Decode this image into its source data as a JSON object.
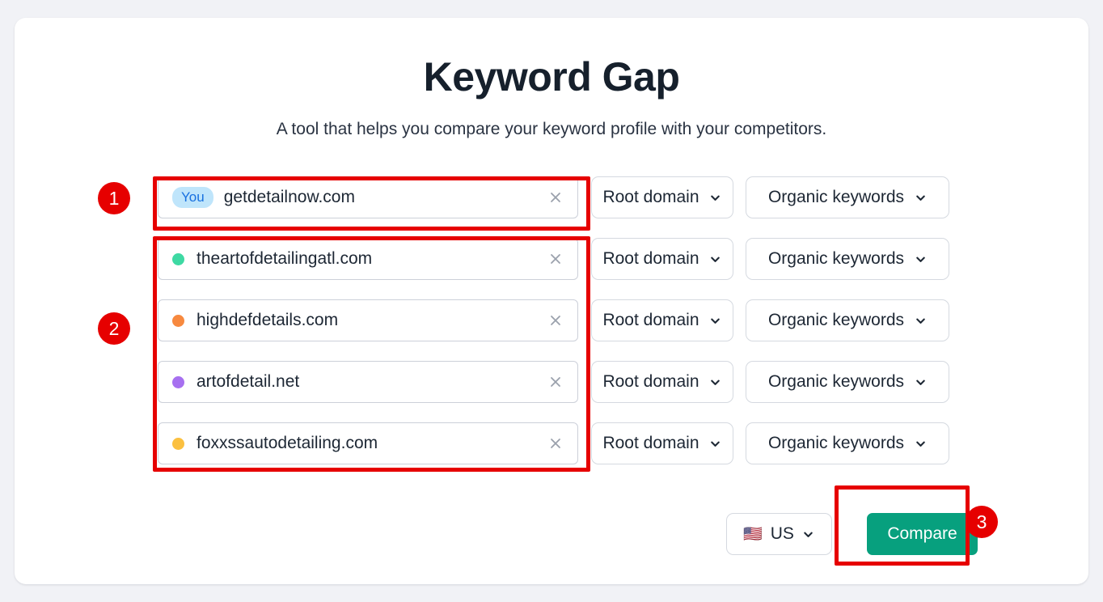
{
  "header": {
    "title": "Keyword Gap",
    "subtitle": "A tool that helps you compare your keyword profile with your competitors."
  },
  "rows": [
    {
      "badge_label": "You",
      "domain": "getdetailnow.com",
      "dot_color": null,
      "scope": "Root domain",
      "metric": "Organic keywords",
      "clear_icon": "close-icon"
    },
    {
      "badge_label": null,
      "domain": "theartofdetailingatl.com",
      "dot_color": "#3ed9a3",
      "scope": "Root domain",
      "metric": "Organic keywords",
      "clear_icon": "close-icon"
    },
    {
      "badge_label": null,
      "domain": "highdefdetails.com",
      "dot_color": "#f7893f",
      "scope": "Root domain",
      "metric": "Organic keywords",
      "clear_icon": "close-icon"
    },
    {
      "badge_label": null,
      "domain": "artofdetail.net",
      "dot_color": "#a770f0",
      "scope": "Root domain",
      "metric": "Organic keywords",
      "clear_icon": "close-icon"
    },
    {
      "badge_label": null,
      "domain": "foxxssautodetailing.com",
      "dot_color": "#fbc040",
      "scope": "Root domain",
      "metric": "Organic keywords",
      "clear_icon": "close-icon"
    }
  ],
  "footer": {
    "country_flag": "🇺🇸",
    "country_label": "US",
    "compare_label": "Compare"
  },
  "annotations": {
    "badges": [
      "1",
      "2",
      "3"
    ],
    "color": "#e60000"
  },
  "colors": {
    "page_background": "#f1f2f6",
    "card_background": "#ffffff",
    "accent_green": "#07a07e",
    "badge_blue_bg": "#bfe5fb",
    "badge_blue_text": "#1770e0",
    "annotation_red": "#e60000"
  }
}
